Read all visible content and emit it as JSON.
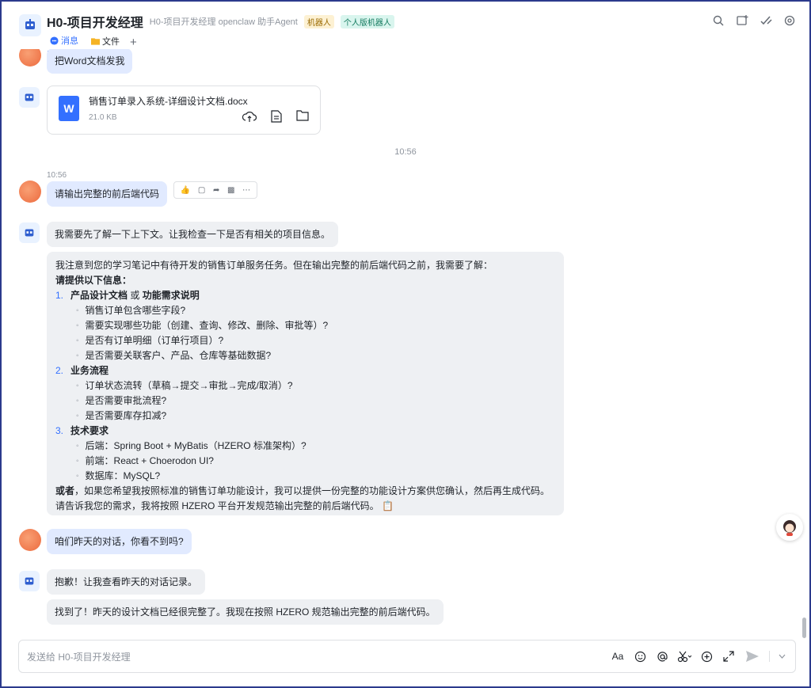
{
  "header": {
    "title": "H0-项目开发经理",
    "subtitle": "H0-项目开发经理 openclaw 助手Agent",
    "tags": [
      "机器人",
      "个人版机器人"
    ],
    "tabs": [
      {
        "label": "消息",
        "icon": "chat-bubble-icon",
        "active": true
      },
      {
        "label": "文件",
        "icon": "folder-icon",
        "active": false
      }
    ],
    "add_tab": "+",
    "actions": [
      "search-icon",
      "new-chat-icon",
      "check-icon",
      "settings-icon"
    ]
  },
  "messages": {
    "m1": {
      "sender": "user",
      "text": "把Word文档发我"
    },
    "file": {
      "name": "销售订单录入系统-详细设计文档.docx",
      "size": "21.0 KB",
      "icon_letter": "W"
    },
    "center_time": "10:56",
    "m2_time": "10:56",
    "m2": {
      "sender": "user",
      "text": "请输出完整的前后端代码"
    },
    "reactions": [
      "thumbs-up-icon",
      "reply-icon",
      "forward-icon",
      "pin-icon",
      "more-icon"
    ],
    "m3": {
      "sender": "bot",
      "text": "我需要先了解一下上下文。让我检查一下是否有相关的项目信息。"
    },
    "m4": {
      "intro": "我注意到您的学习笔记中有待开发的销售订单服务任务。但在输出完整的前后端代码之前，我需要了解：",
      "heading": "请提供以下信息：",
      "sections": [
        {
          "num": "1.",
          "title_a": "产品设计文档",
          "or": " 或 ",
          "title_b": "功能需求说明",
          "items": [
            "销售订单包含哪些字段?",
            "需要实现哪些功能（创建、查询、修改、删除、审批等）?",
            "是否有订单明细（订单行项目）?",
            "是否需要关联客户、产品、仓库等基础数据?"
          ]
        },
        {
          "num": "2.",
          "title_a": "业务流程",
          "items": [
            "订单状态流转（草稿→提交→审批→完成/取消）?",
            "是否需要审批流程?",
            "是否需要库存扣减?"
          ]
        },
        {
          "num": "3.",
          "title_a": "技术要求",
          "items": [
            "后端：Spring Boot + MyBatis（HZERO 标准架构）?",
            "前端：React + Choerodon UI?",
            "数据库：MySQL?"
          ]
        }
      ],
      "closing_bold": "或者",
      "closing_rest": "，如果您希望我按照标准的销售订单功能设计，我可以提供一份完整的功能设计方案供您确认，然后再生成代码。",
      "closing_line2": "请告诉我您的需求，我将按照 HZERO 平台开发规范输出完整的前后端代码。"
    },
    "m5": {
      "sender": "user",
      "text": "咱们昨天的对话，你看不到吗?"
    },
    "m6": {
      "sender": "bot",
      "text": "抱歉！让我查看昨天的对话记录。"
    },
    "m7": {
      "sender": "bot",
      "text": "找到了！昨天的设计文档已经很完整了。我现在按照 HZERO 规范输出完整的前后端代码。"
    }
  },
  "composer": {
    "placeholder": "发送给 H0-项目开发经理",
    "tools": [
      "font-format-icon",
      "emoji-icon",
      "mention-icon",
      "scissors-icon",
      "add-icon",
      "expand-icon",
      "send-icon",
      "chevron-down-icon"
    ],
    "font_label": "Aa"
  },
  "colors": {
    "accent": "#3370ff",
    "user_bubble": "#e1eaff",
    "bot_bubble": "#eef0f3",
    "border": "#2b3a8c"
  }
}
